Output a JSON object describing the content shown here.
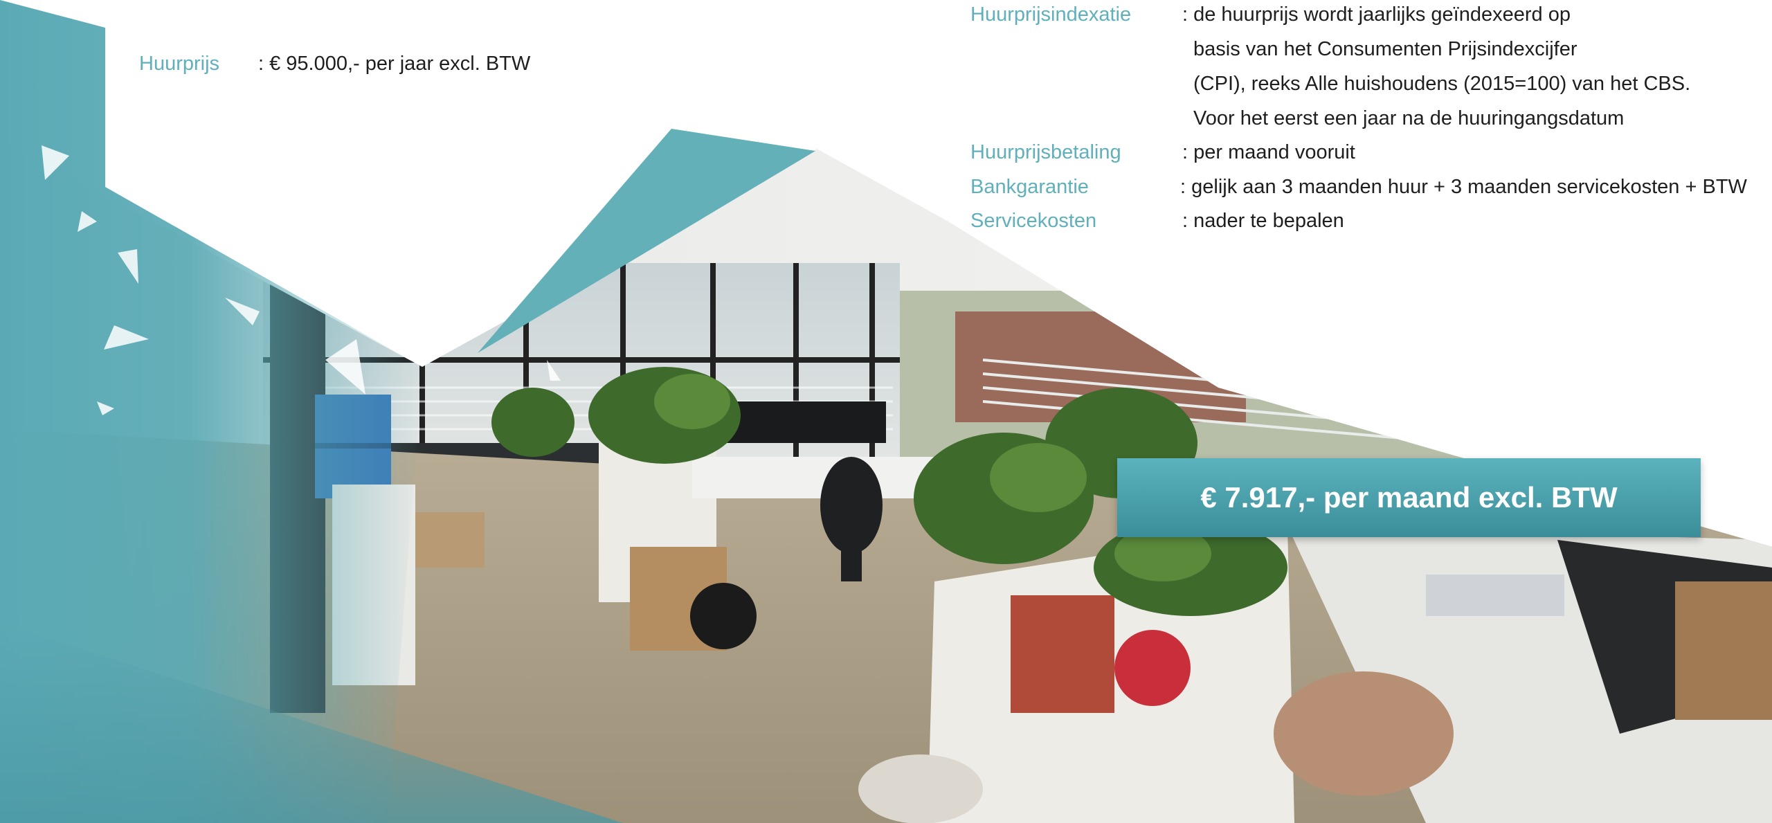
{
  "left_info": {
    "huurprijs_label": "Huurprijs",
    "huurprijs_value": ": € 95.000,- per jaar excl. BTW"
  },
  "right_info": {
    "rows": [
      {
        "label": "Huurprijsindexatie",
        "value": ": de huurprijs wordt jaarlijks geïndexeerd op"
      },
      {
        "label": "",
        "value": "basis van het  Consumenten Prijsindexcijfer"
      },
      {
        "label": "",
        "value": "(CPI), reeks Alle huishoudens (2015=100) van het CBS."
      },
      {
        "label": "",
        "value": "Voor het eerst een jaar na de huuringangsdatum"
      },
      {
        "label": "Huurprijsbetaling",
        "value": ": per maand vooruit"
      },
      {
        "label": "Bankgarantie",
        "value": ": gelijk aan 3 maanden huur + 3 maanden servicekosten + BTW"
      },
      {
        "label": "Servicekosten",
        "value": ": nader te bepalen"
      }
    ]
  },
  "price_banner": {
    "text": "€ 7.917,- per maand excl. BTW"
  },
  "colors": {
    "accent": "#5fb0ba",
    "banner": "#4aa2ad",
    "text": "#1e1e1e"
  }
}
